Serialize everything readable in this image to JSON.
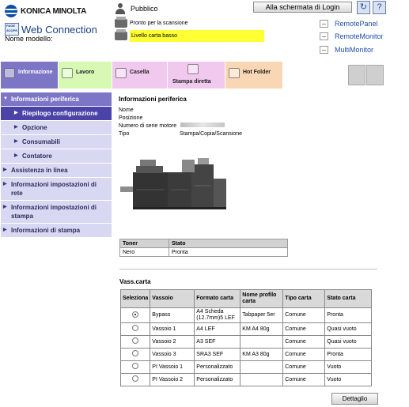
{
  "brand": {
    "company": "KONICA MINOLTA",
    "pagescope_mark": "PAGE SCOPE",
    "product": "Web Connection",
    "model_label": "Nome modello:"
  },
  "header": {
    "user": "Pubblico",
    "login_button": "Alla schermata di Login",
    "refresh_icon": "refresh-icon",
    "help_icon": "help-icon",
    "refresh_glyph": "↻",
    "help_glyph": "?",
    "status_ready": "Pronto per la scansione",
    "status_warning": "Livello carta basso",
    "warning_color": "#ffff33"
  },
  "remote_links": [
    "RemotePanel",
    "RemoteMonitor",
    "MultiMonitor"
  ],
  "tabs": [
    {
      "label": "Informazione",
      "color": "#7d76c7",
      "active": true
    },
    {
      "label": "Lavoro",
      "color": "#d7f9b3"
    },
    {
      "label": "Casella",
      "color": "#f1c8ee"
    },
    {
      "label": "Stampa diretta",
      "color": "#f1c8ee"
    },
    {
      "label": "Hot Folder",
      "color": "#f9d7b4"
    }
  ],
  "sidebar": {
    "items": [
      {
        "label": "Informazioni periferica"
      },
      {
        "label": "Riepilogo configurazione"
      },
      {
        "label": "Opzione"
      },
      {
        "label": "Consumabili"
      },
      {
        "label": "Contatore"
      },
      {
        "label": "Assistenza in linea"
      },
      {
        "label": "Informazioni impostazioni di rete"
      },
      {
        "label": "Informazioni impostazioni di stampa"
      },
      {
        "label": "Informazioni di stampa"
      }
    ]
  },
  "main": {
    "title": "Informazioni periferica",
    "fields": [
      {
        "key": "Nome",
        "value": ""
      },
      {
        "key": "Posizione",
        "value": ""
      },
      {
        "key": "Numero di serie motore",
        "value": ""
      },
      {
        "key": "Tipo",
        "value": "Stampa/Copia/Scansione"
      }
    ]
  },
  "toner": {
    "headers": [
      "Toner",
      "Stato"
    ],
    "rows": [
      [
        "Nero",
        "Pronta"
      ]
    ]
  },
  "vassoi": {
    "title": "Vass.carta",
    "headers": [
      "Seleziona",
      "Vassoio",
      "Formato carta",
      "Nome profilo carta",
      "Tipo carta",
      "Stato carta"
    ],
    "rows": [
      {
        "selected": true,
        "tray": "Bypass",
        "format": "A4 Scheda (12.7mm)5 LEF",
        "profile": "Tabpaper 5er",
        "type": "Comune",
        "status": "Pronta"
      },
      {
        "selected": false,
        "tray": "Vassoio 1",
        "format": "A4 LEF",
        "profile": "KM A4 80g",
        "type": "Comune",
        "status": "Quasi vuoto"
      },
      {
        "selected": false,
        "tray": "Vassoio 2",
        "format": "A3 SEF",
        "profile": "",
        "type": "Comune",
        "status": "Quasi vuoto"
      },
      {
        "selected": false,
        "tray": "Vassoio 3",
        "format": "SRA3 SEF",
        "profile": "KM A3 80g",
        "type": "Comune",
        "status": "Pronta"
      },
      {
        "selected": false,
        "tray": "PI Vassoio 1",
        "format": "Personalizzato",
        "profile": "",
        "type": "Comune",
        "status": "Vuoto"
      },
      {
        "selected": false,
        "tray": "PI Vassoio 2",
        "format": "Personalizzato",
        "profile": "",
        "type": "Comune",
        "status": "Vuoto"
      }
    ],
    "detail_button": "Dettaglio"
  }
}
